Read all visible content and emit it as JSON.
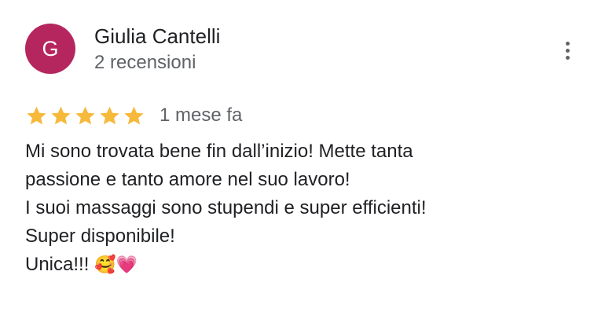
{
  "author": {
    "initial": "G",
    "name": "Giulia Cantelli",
    "meta": "2 recensioni",
    "avatar_color": "#b5265f"
  },
  "menu": {
    "icon": "more-vert-icon"
  },
  "rating": {
    "stars": 5,
    "max_stars": 5,
    "star_color": "#f6b93b",
    "time": "1 mese fa"
  },
  "review": {
    "lines": [
      "Mi sono trovata bene fin dall’inizio! Mette tanta",
      "passione e tanto amore nel suo lavoro!",
      "I suoi massaggi sono stupendi e super efficienti!",
      "Super disponibile!",
      "Unica!!!"
    ],
    "emojis": "🥰💗"
  }
}
